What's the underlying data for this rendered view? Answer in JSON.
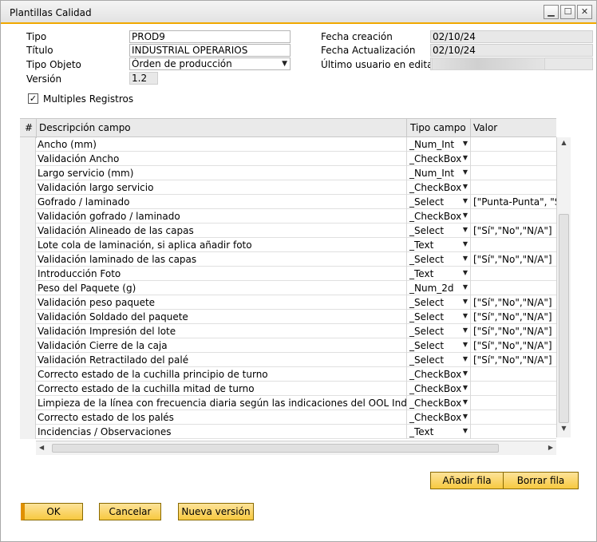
{
  "window": {
    "title": "Plantillas Calidad"
  },
  "form": {
    "tipo_label": "Tipo",
    "tipo_value": "PROD9",
    "titulo_label": "Título",
    "titulo_value": "INDUSTRIAL OPERARIOS",
    "tipo_objeto_label": "Tipo Objeto",
    "tipo_objeto_value": "Órden de producción",
    "version_label": "Versión",
    "version_value": "1.2",
    "fecha_creacion_label": "Fecha creación",
    "fecha_creacion_value": "02/10/24",
    "fecha_actualizacion_label": "Fecha Actualización",
    "fecha_actualizacion_value": "02/10/24",
    "ultimo_usuario_label": "Último usuario en editar",
    "multiples_label": "Multiples Registros"
  },
  "grid": {
    "headers": [
      "#",
      "Descripción campo",
      "Tipo campo",
      "Valor"
    ],
    "rows": [
      {
        "desc": "Ancho (mm)",
        "tipo": "_Num_Int",
        "valor": ""
      },
      {
        "desc": "Validación Ancho",
        "tipo": "_CheckBox",
        "valor": ""
      },
      {
        "desc": "Largo servicio (mm)",
        "tipo": "_Num_Int",
        "valor": ""
      },
      {
        "desc": "Validación largo servicio",
        "tipo": "_CheckBox",
        "valor": ""
      },
      {
        "desc": "Gofrado / laminado",
        "tipo": "_Select",
        "valor": "[\"Punta-Punta\", \"St"
      },
      {
        "desc": "Validación gofrado / laminado",
        "tipo": "_CheckBox",
        "valor": ""
      },
      {
        "desc": "Validación Alineado de las capas",
        "tipo": "_Select",
        "valor": "[\"Sí\",\"No\",\"N/A\"]"
      },
      {
        "desc": "Lote cola de laminación, si aplica añadir foto",
        "tipo": "_Text",
        "valor": ""
      },
      {
        "desc": "Validación laminado de las capas",
        "tipo": "_Select",
        "valor": "[\"Sí\",\"No\",\"N/A\"]"
      },
      {
        "desc": "Introducción Foto",
        "tipo": "_Text",
        "valor": ""
      },
      {
        "desc": "Peso del Paquete (g)",
        "tipo": "_Num_2d",
        "valor": ""
      },
      {
        "desc": "Validación peso paquete",
        "tipo": "_Select",
        "valor": "[\"Sí\",\"No\",\"N/A\"]"
      },
      {
        "desc": "Validación Soldado del paquete",
        "tipo": "_Select",
        "valor": "[\"Sí\",\"No\",\"N/A\"]"
      },
      {
        "desc": "Validación Impresión del lote",
        "tipo": "_Select",
        "valor": "[\"Sí\",\"No\",\"N/A\"]"
      },
      {
        "desc": "Validación Cierre de la caja",
        "tipo": "_Select",
        "valor": "[\"Sí\",\"No\",\"N/A\"]"
      },
      {
        "desc": "Validación Retractilado del palé",
        "tipo": "_Select",
        "valor": "[\"Sí\",\"No\",\"N/A\"]"
      },
      {
        "desc": "Correcto estado de la cuchilla principio de turno",
        "tipo": "_CheckBox",
        "valor": ""
      },
      {
        "desc": "Correcto estado de la cuchilla mitad de turno",
        "tipo": "_CheckBox",
        "valor": ""
      },
      {
        "desc": "Limpieza de la línea con frecuencia diaria según las indicaciones del OOL Industrial",
        "tipo": "_CheckBox",
        "valor": ""
      },
      {
        "desc": "Correcto estado de los palés",
        "tipo": "_CheckBox",
        "valor": ""
      },
      {
        "desc": "Incidencias / Observaciones",
        "tipo": "_Text",
        "valor": ""
      }
    ]
  },
  "buttons": {
    "add_row": "Añadir fila",
    "delete_row": "Borrar fila",
    "ok": "OK",
    "cancel": "Cancelar",
    "new_version": "Nueva versión"
  }
}
